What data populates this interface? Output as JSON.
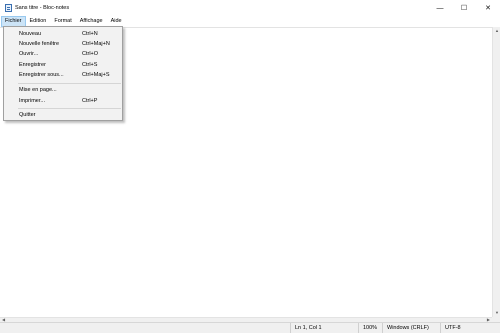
{
  "window": {
    "title": "Sans titre - Bloc-notes",
    "controls": {
      "minimize": "—",
      "maximize": "☐",
      "close": "✕"
    }
  },
  "menubar": [
    {
      "label": "Fichier",
      "active": true
    },
    {
      "label": "Edition"
    },
    {
      "label": "Format"
    },
    {
      "label": "Affichage"
    },
    {
      "label": "Aide"
    }
  ],
  "file_menu": {
    "items": [
      {
        "label": "Nouveau",
        "shortcut": "Ctrl+N"
      },
      {
        "label": "Nouvelle fenêtre",
        "shortcut": "Ctrl+Maj+N"
      },
      {
        "label": "Ouvrir...",
        "shortcut": "Ctrl+O"
      },
      {
        "label": "Enregistrer",
        "shortcut": "Ctrl+S"
      },
      {
        "label": "Enregistrer sous...",
        "shortcut": "Ctrl+Maj+S"
      },
      {
        "label": "Mise en page...",
        "shortcut": ""
      },
      {
        "label": "Imprimer...",
        "shortcut": "Ctrl+P"
      },
      {
        "label": "Quitter",
        "shortcut": ""
      }
    ]
  },
  "editor": {
    "content": ""
  },
  "statusbar": {
    "position": "Ln 1, Col 1",
    "zoom": "100%",
    "line_ending": "Windows (CRLF)",
    "encoding": "UTF-8"
  }
}
